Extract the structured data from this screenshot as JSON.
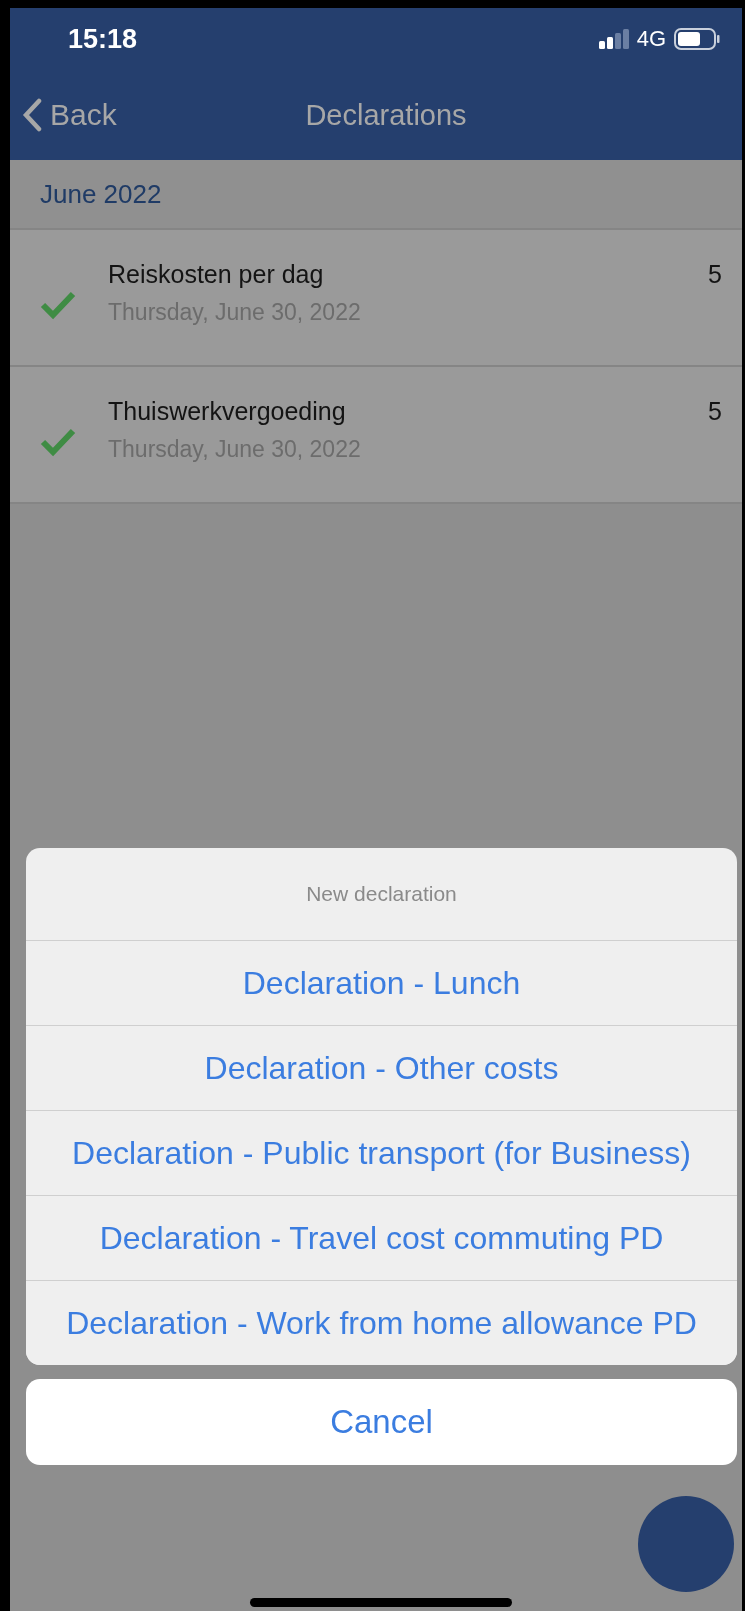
{
  "status_bar": {
    "time": "15:18",
    "network": "4G"
  },
  "nav": {
    "back": "Back",
    "title": "Declarations"
  },
  "section": {
    "title": "June 2022"
  },
  "declarations": [
    {
      "title": "Reiskosten per dag",
      "date": "Thursday, June 30, 2022",
      "count": "5",
      "approved": true
    },
    {
      "title": "Thuiswerkvergoeding",
      "date": "Thursday, June 30, 2022",
      "count": "5",
      "approved": true
    }
  ],
  "action_sheet": {
    "title": "New declaration",
    "options": [
      "Declaration - Lunch",
      "Declaration - Other costs",
      "Declaration - Public transport (for Business)",
      "Declaration - Travel cost commuting PD",
      "Declaration - Work from home allowance PD"
    ],
    "cancel": "Cancel"
  }
}
